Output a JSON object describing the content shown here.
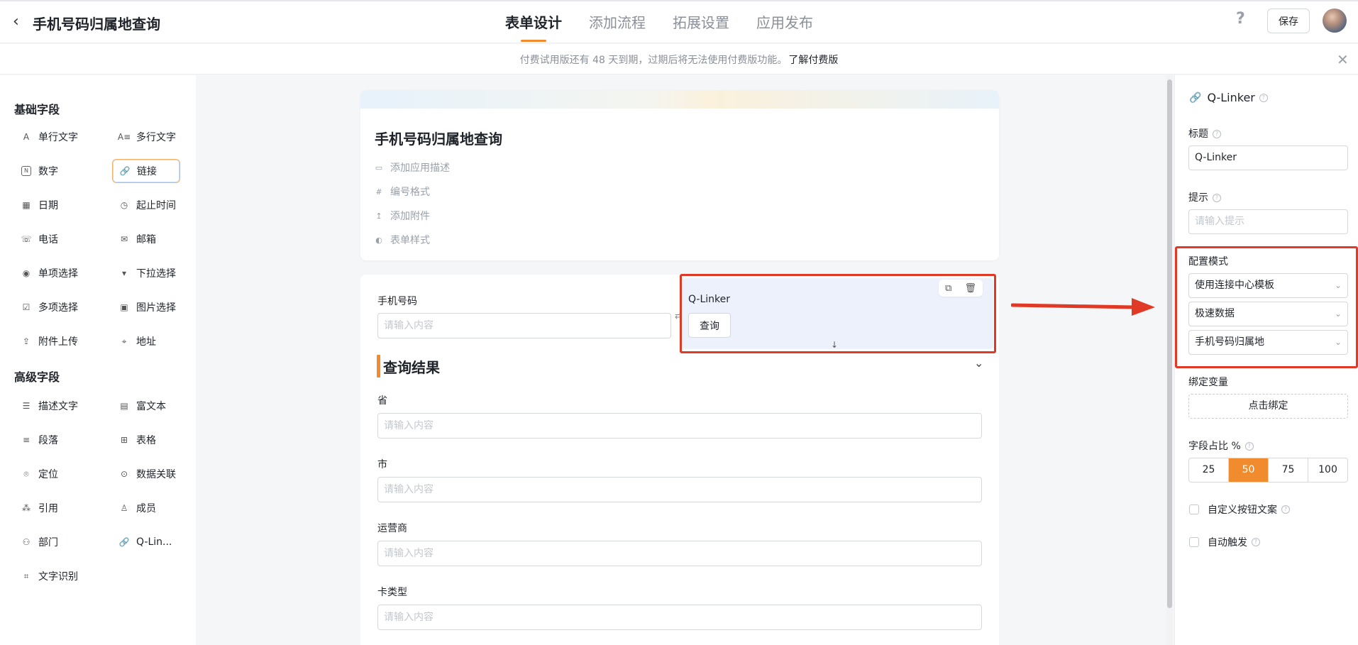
{
  "header": {
    "back_icon": "chevron-left-icon",
    "title": "手机号码归属地查询",
    "tabs": [
      {
        "label": "表单设计",
        "active": true
      },
      {
        "label": "添加流程",
        "active": false
      },
      {
        "label": "拓展设置",
        "active": false
      },
      {
        "label": "应用发布",
        "active": false
      }
    ],
    "help": "?",
    "save_label": "保存",
    "accent_color": "#f08c2e"
  },
  "notice": {
    "text": "付费试用版还有 48 天到期，过期后将无法使用付费版功能。",
    "link": "了解付费版"
  },
  "left_panel": {
    "basic_title": "基础字段",
    "basic_fields": [
      {
        "label": "单行文字",
        "icon": "A"
      },
      {
        "label": "多行文字",
        "icon": "A≡"
      },
      {
        "label": "数字",
        "icon": "N"
      },
      {
        "label": "链接",
        "icon": "🔗"
      },
      {
        "label": "日期",
        "icon": "▦"
      },
      {
        "label": "起止时间",
        "icon": "◷"
      },
      {
        "label": "电话",
        "icon": "☏"
      },
      {
        "label": "邮箱",
        "icon": "✉"
      },
      {
        "label": "单项选择",
        "icon": "◉"
      },
      {
        "label": "下拉选择",
        "icon": "▾"
      },
      {
        "label": "多项选择",
        "icon": "☑"
      },
      {
        "label": "图片选择",
        "icon": "▣"
      },
      {
        "label": "附件上传",
        "icon": "⇪"
      },
      {
        "label": "地址",
        "icon": "⌖"
      }
    ],
    "advanced_title": "高级字段",
    "advanced_fields": [
      {
        "label": "描述文字",
        "icon": "☰"
      },
      {
        "label": "富文本",
        "icon": "▤"
      },
      {
        "label": "段落",
        "icon": "≡"
      },
      {
        "label": "表格",
        "icon": "⊞"
      },
      {
        "label": "定位",
        "icon": "⌾"
      },
      {
        "label": "数据关联",
        "icon": "⊙"
      },
      {
        "label": "引用",
        "icon": "⁂"
      },
      {
        "label": "成员",
        "icon": "♙"
      },
      {
        "label": "部门",
        "icon": "⚇"
      },
      {
        "label": "Q-Lin...",
        "icon": "🔗"
      },
      {
        "label": "文字识别",
        "icon": "⌗"
      }
    ]
  },
  "form": {
    "title": "手机号码归属地查询",
    "options": [
      {
        "label": "添加应用描述",
        "icon": "▭"
      },
      {
        "label": "编号格式",
        "icon": "#"
      },
      {
        "label": "添加附件",
        "icon": "↥"
      },
      {
        "label": "表单样式",
        "icon": "◐"
      }
    ],
    "phone_label": "手机号码",
    "placeholder": "请输入内容",
    "qlinker_title": "Q-Linker",
    "query_button": "查询",
    "result_section": "查询结果",
    "result_fields": [
      {
        "label": "省"
      },
      {
        "label": "市"
      },
      {
        "label": "运营商"
      },
      {
        "label": "卡类型"
      }
    ]
  },
  "right_panel": {
    "title": "Q-Linker",
    "label_title": "标题",
    "title_value": "Q-Linker",
    "label_hint": "提示",
    "hint_placeholder": "请输入提示",
    "label_config": "配置模式",
    "config_mode": "使用连接中心模板",
    "config_source": "极速数据",
    "config_template": "手机号码归属地",
    "label_bind": "绑定变量",
    "bind_button": "点击绑定",
    "label_ratio": "字段占比 %",
    "ratio_options": [
      "25",
      "50",
      "75",
      "100"
    ],
    "ratio_selected": "50",
    "custom_button_text": "自定义按钮文案",
    "auto_trigger": "自动触发"
  },
  "annotation_color": "#e03a26"
}
